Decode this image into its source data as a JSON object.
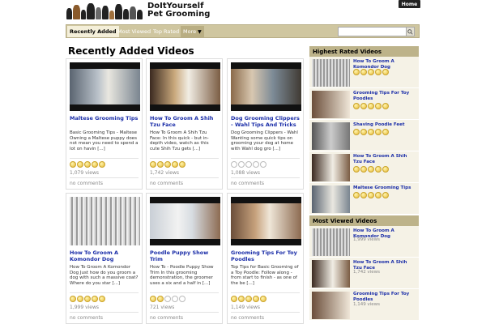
{
  "header": {
    "brand_line1": "DoItYourself",
    "brand_line2": "Pet Grooming",
    "home_label": "Home"
  },
  "nav": {
    "tabs": [
      {
        "label": "Recently Added"
      },
      {
        "label": "Most Viewed"
      },
      {
        "label": "Top Rated"
      },
      {
        "label": "More"
      }
    ],
    "search_placeholder": ""
  },
  "main": {
    "title": "Recently Added Videos",
    "cards": [
      {
        "title": "Maltese Grooming Tips",
        "desc": "Basic Grooming Tips - Maltese Owning a Maltese puppy does not mean you need to spend a lot on havin [...]",
        "rating": 5,
        "views": "1,079 views",
        "comments": "no comments"
      },
      {
        "title": "How To Groom A Shih Tzu Face",
        "desc": "How To Groom A Shih Tzu Face: In this quick - but in-depth video, watch as this cute Shih Tzu gets [...]",
        "rating": 5,
        "views": "1,742 views",
        "comments": "no comments"
      },
      {
        "title": "Dog Grooming Clippers - Wahl Tips And Tricks",
        "desc": "Dog Grooming Clippers - Wahl Wanting some quick tips on grooming your dog at home with Wahl dog gro [...]",
        "rating": 0,
        "views": "1,088 views",
        "comments": "no comments"
      },
      {
        "title": "How To Groom A Komondor Dog",
        "desc": "How To Groom A Komondor Dog Just how do you groom a dog with such a massive coat? Where do you star [...]",
        "rating": 5,
        "views": "1,999 views",
        "comments": "no comments"
      },
      {
        "title": "Poodle Puppy Show Trim",
        "desc": "How To - Poodle Puppy Show Trim In this grooming demonstration, the groomer uses a six and a half in [...]",
        "rating": 2,
        "views": "721 views",
        "comments": "no comments"
      },
      {
        "title": "Grooming Tips For Toy Poodles",
        "desc": "Top Tips for Basic Grooming of a Toy Poodle: Follow along - from start to finish - as one of the be [...]",
        "rating": 5,
        "views": "1,149 views",
        "comments": "no comments"
      }
    ]
  },
  "sidebar": {
    "top_rated_title": "Highest Rated Videos",
    "top_rated": [
      {
        "title": "How To Groom A Komondor Dog"
      },
      {
        "title": "Grooming Tips For Toy Poodles"
      },
      {
        "title": "Shaving Poodle Feet"
      },
      {
        "title": "How To Groom A Shih Tzu Face"
      },
      {
        "title": "Maltese Grooming Tips"
      }
    ],
    "most_viewed_title": "Most Viewed Videos",
    "most_viewed": [
      {
        "title": "How To Groom A Komondor Dog",
        "views": "1,999 views"
      },
      {
        "title": "How To Groom A Shih Tzu Face",
        "views": "1,742 views"
      },
      {
        "title": "Grooming Tips For Toy Poodles",
        "views": "1,149 views"
      }
    ]
  },
  "colors": {
    "link": "#1a2da8",
    "nav_bg": "#cfc6a0",
    "sidebar_header": "#bdb38a",
    "star": "#e7b834"
  }
}
